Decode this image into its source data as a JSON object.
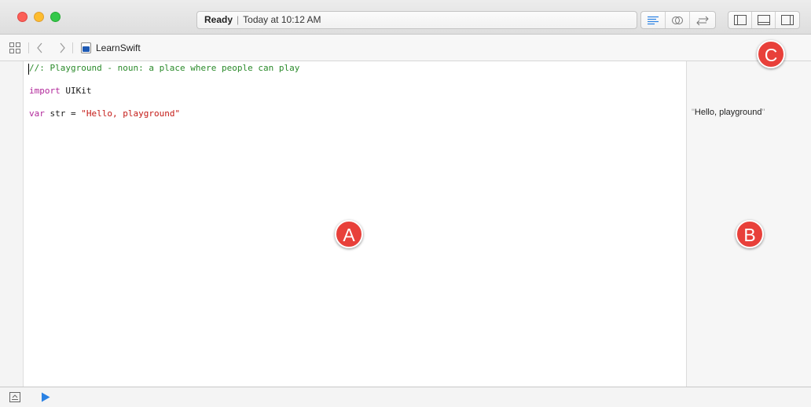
{
  "window": {
    "status_ready": "Ready",
    "status_separator": "|",
    "status_time": "Today at 10:12 AM"
  },
  "toolbar": {
    "editor_buttons": [
      "standard-editor-icon",
      "assistant-editor-icon",
      "version-editor-icon"
    ],
    "view_buttons": [
      "navigator-toggle-icon",
      "debug-area-toggle-icon",
      "utilities-toggle-icon"
    ]
  },
  "jumpbar": {
    "file_name": "LearnSwift"
  },
  "editor": {
    "lines": [
      {
        "comment": "//: Playground - noun: a place where people can play"
      },
      {
        "keyword": "import",
        "text": " UIKit"
      },
      {
        "keyword": "var",
        "text": " str = ",
        "string": "\"Hello, playground\""
      }
    ]
  },
  "results": {
    "value": "Hello, playground"
  },
  "callouts": {
    "a": "A",
    "b": "B",
    "c": "C"
  },
  "colors": {
    "comment": "#2a8a2a",
    "keyword": "#b1279a",
    "string": "#c41a16",
    "badge": "#e8403a",
    "run_button": "#2a82e4"
  }
}
